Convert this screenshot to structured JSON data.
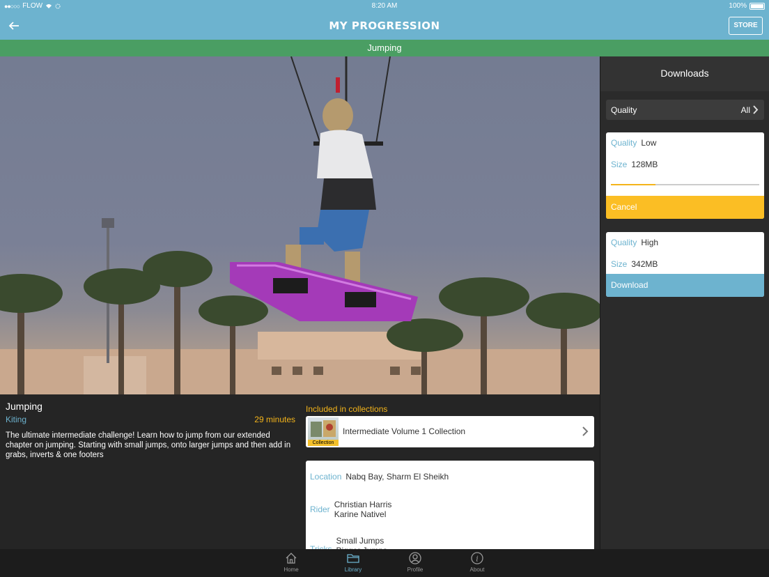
{
  "status": {
    "carrier": "FLOW",
    "time": "8:20 AM",
    "battery": "100%"
  },
  "nav": {
    "title": "MY PROGRESSION",
    "store_label": "STORE",
    "back_icon": "back-arrow-icon"
  },
  "subtitle": "Jumping",
  "media": {
    "scene": "kitesurfer-jumping-photo"
  },
  "info": {
    "title": "Jumping",
    "category": "Kiting",
    "duration": "29 minutes",
    "description": "The ultimate intermediate challenge!   Learn how to jump from our extended chapter on jumping.  Starting with small jumps, onto larger jumps and then add in grabs, inverts & one footers"
  },
  "collections": {
    "heading": "Included in collections",
    "items": [
      {
        "name": "Intermediate Volume 1 Collection",
        "tag": "Collection"
      }
    ]
  },
  "details": {
    "location_label": "Location",
    "location": "Nabq Bay, Sharm El Sheikh",
    "rider_label": "Rider",
    "riders": [
      "Christian Harris",
      "Karine Nativel"
    ],
    "tricks_label": "Tricks",
    "tricks": [
      "Small Jumps",
      "Bigger Jumps"
    ]
  },
  "downloads": {
    "title": "Downloads",
    "quality_filter_label": "Quality",
    "quality_filter_value": "All",
    "items": [
      {
        "quality_label": "Quality",
        "quality": "Low",
        "size_label": "Size",
        "size": "128MB",
        "progress": 0.3,
        "action": "Cancel"
      },
      {
        "quality_label": "Quality",
        "quality": "High",
        "size_label": "Size",
        "size": "342MB",
        "action": "Download"
      }
    ]
  },
  "tabs": [
    {
      "label": "Home",
      "icon": "home-icon"
    },
    {
      "label": "Library",
      "icon": "folder-icon",
      "active": true
    },
    {
      "label": "Profile",
      "icon": "profile-icon"
    },
    {
      "label": "About",
      "icon": "info-icon"
    }
  ],
  "colors": {
    "nav": "#6db3cf",
    "subtitle_bar": "#4a9e63",
    "accent": "#f4b41a",
    "link": "#6db3cf"
  }
}
